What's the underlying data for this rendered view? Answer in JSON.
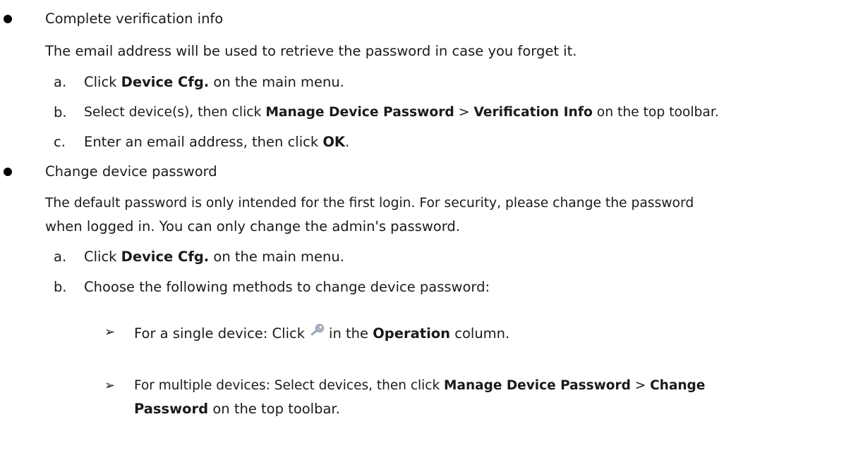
{
  "section1": {
    "heading": "Complete verification info",
    "description": "The email address will be used to retrieve the password in case you forget it.",
    "steps": [
      {
        "marker": "a.",
        "t1": "Click ",
        "b1": "Device Cfg.",
        "t2": " on the main menu."
      },
      {
        "marker": "b.",
        "t1": "Select device(s), then click ",
        "b1": "Manage Device Password",
        "t2": " > ",
        "b2": "Verification Info",
        "t3": " on the top toolbar."
      },
      {
        "marker": "c.",
        "t1": "Enter an email address, then click ",
        "b1": "OK",
        "t2": "."
      }
    ]
  },
  "section2": {
    "heading": "Change device password",
    "description_line1": "The default password is only intended for the first login. For security, please change the password",
    "description_line2": "when logged in. You can only change the admin's password.",
    "steps": [
      {
        "marker": "a.",
        "t1": "Click ",
        "b1": "Device Cfg.",
        "t2": " on the main menu."
      },
      {
        "marker": "b.",
        "t1": "Choose the following methods to change device password:"
      }
    ],
    "substeps": [
      {
        "t1": "For a single device: Click",
        "icon": "key-icon",
        "t2": "in the ",
        "b1": "Operation",
        "t3": " column."
      },
      {
        "t1": "For multiple devices: Select devices, then click ",
        "b1": "Manage Device Password",
        "t2": " > ",
        "b2": "Change",
        "b3": "Password",
        "t3": " on the top toolbar."
      }
    ]
  }
}
